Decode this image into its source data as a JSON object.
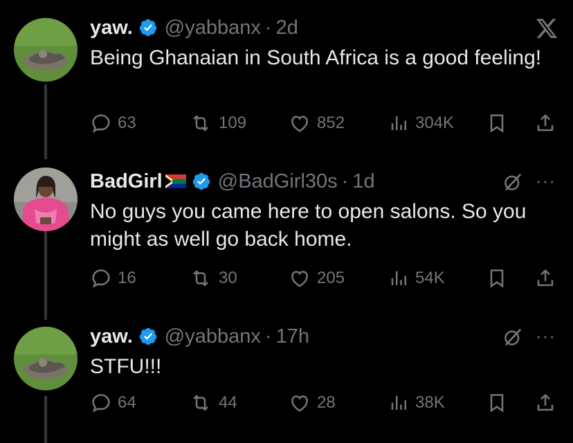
{
  "tweets": [
    {
      "name": "yaw.",
      "handle": "@yabbanx",
      "separator": "·",
      "time": "2d",
      "text": "Being Ghanaian in South Africa is a good feeling!",
      "replies": "63",
      "reposts": "109",
      "likes": "852",
      "views": "304K",
      "corner_icon": "x-logo-icon"
    },
    {
      "name": "BadGirl",
      "flag": "south-africa-flag-emoji",
      "handle": "@BadGirl30s",
      "separator": "·",
      "time": "1d",
      "text": "No guys you came here to open salons. So you might as well go back home.",
      "replies": "16",
      "reposts": "30",
      "likes": "205",
      "views": "54K",
      "corner_icon": "grok-icon"
    },
    {
      "name": "yaw.",
      "handle": "@yabbanx",
      "separator": "·",
      "time": "17h",
      "text": "STFU!!!",
      "replies": "64",
      "reposts": "44",
      "likes": "28",
      "views": "38K",
      "corner_icon": "grok-icon"
    }
  ],
  "more_label": "···",
  "colors": {
    "background": "#000000",
    "text": "#e7e9ea",
    "muted": "#71767b",
    "verified": "#1d9bf0",
    "thread_line": "#333639"
  }
}
